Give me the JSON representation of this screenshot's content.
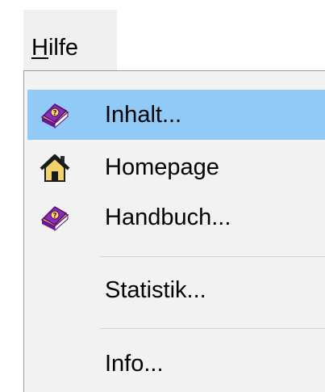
{
  "menu_title": {
    "mnemonic": "H",
    "rest": "ilfe"
  },
  "menu_items": [
    {
      "label": "Inhalt...",
      "icon": "help-book-icon",
      "highlighted": true
    },
    {
      "label": "Homepage",
      "icon": "home-icon",
      "highlighted": false
    },
    {
      "label": "Handbuch...",
      "icon": "help-book-icon",
      "highlighted": false
    },
    {
      "label": "Statistik...",
      "icon": "",
      "highlighted": false
    },
    {
      "label": "Info...",
      "icon": "",
      "highlighted": false
    }
  ],
  "colors": {
    "highlight": "#91c9f7",
    "menu_background": "#f2f2f2",
    "book_purple": "#7a1fa6",
    "book_pages": "#ffe14d"
  }
}
